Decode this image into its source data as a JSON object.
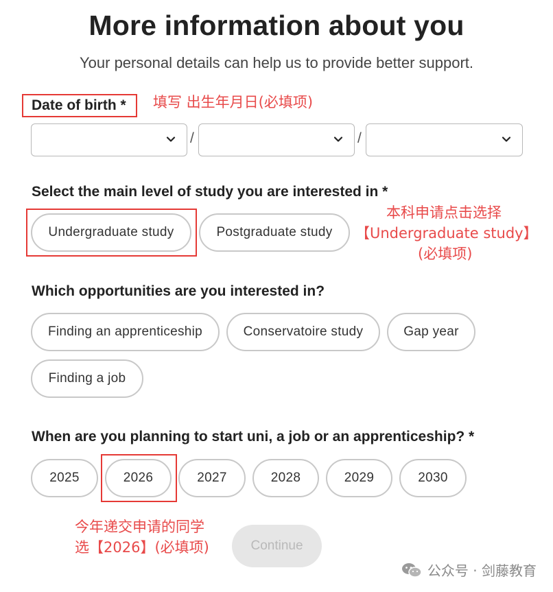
{
  "header": {
    "title": "More information about you",
    "subtitle": "Your personal details can help us to provide better support."
  },
  "dob": {
    "label": "Date of birth *",
    "separator": "/",
    "day_value": "",
    "month_value": "",
    "year_value": ""
  },
  "study_level": {
    "label": "Select the main level of study you are interested in *",
    "options": [
      "Undergraduate study",
      "Postgraduate study"
    ]
  },
  "opportunities": {
    "label": "Which opportunities are you interested in?",
    "options": [
      "Finding an apprenticeship",
      "Conservatoire study",
      "Gap year",
      "Finding a job"
    ]
  },
  "start_year": {
    "label": "When are you planning to start uni, a job or an apprenticeship? *",
    "options": [
      "2025",
      "2026",
      "2027",
      "2028",
      "2029",
      "2030"
    ]
  },
  "continue_label": "Continue",
  "annotations": {
    "dob_note": "填写 出生年月日(必填项)",
    "study_note_line1": "本科申请点击选择",
    "study_note_line2": "【Undergraduate study】",
    "study_note_line3": "(必填项)",
    "year_note_line1": "今年递交申请的同学",
    "year_note_line2": "选【2026】(必填项)"
  },
  "watermark": {
    "text": "公众号 · 剑藤教育",
    "icon": "wechat-icon"
  },
  "colors": {
    "annotation_red": "#e53935",
    "pill_border": "#c8c8c8",
    "continue_disabled_bg": "#e6e6e6",
    "continue_disabled_text": "#b9b9b9"
  }
}
